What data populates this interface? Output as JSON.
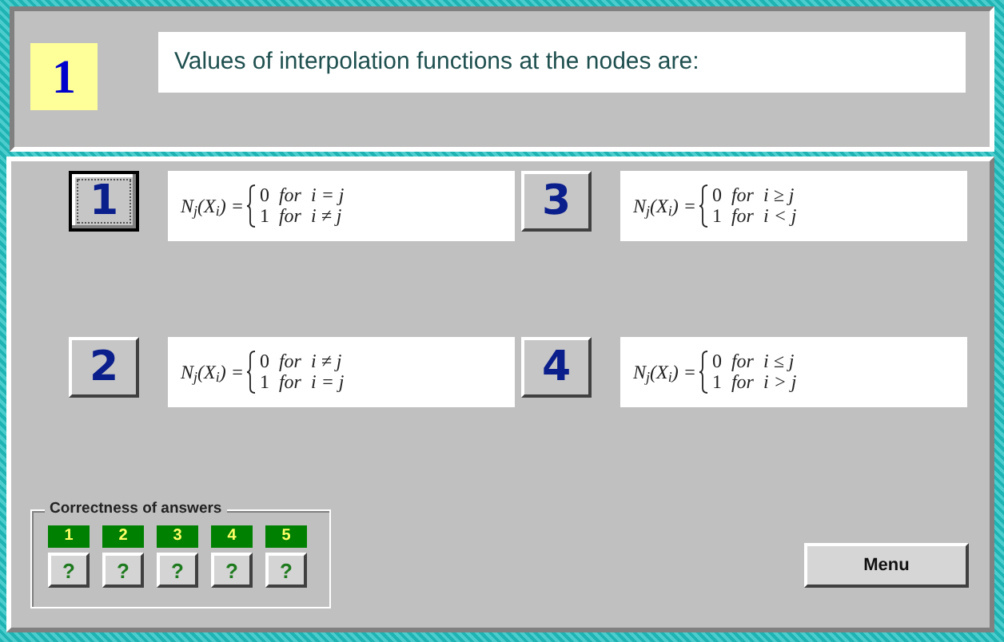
{
  "question": {
    "number": "1",
    "text": "Values of interpolation functions at the nodes are:"
  },
  "options": [
    {
      "label": "1",
      "selected": true,
      "lhs": "N$_{j}$(X$_{i}$) =",
      "cases": [
        {
          "value": "0",
          "word": "for",
          "condition": "i = j"
        },
        {
          "value": "1",
          "word": "for",
          "condition": "i ≠ j"
        }
      ]
    },
    {
      "label": "2",
      "selected": false,
      "lhs": "N$_{j}$(X$_{i}$) =",
      "cases": [
        {
          "value": "0",
          "word": "for",
          "condition": "i ≠ j"
        },
        {
          "value": "1",
          "word": "for",
          "condition": "i = j"
        }
      ]
    },
    {
      "label": "3",
      "selected": false,
      "lhs": "N$_{j}$(X$_{i}$) =",
      "cases": [
        {
          "value": "0",
          "word": "for",
          "condition": "i ≥ j"
        },
        {
          "value": "1",
          "word": "for",
          "condition": "i < j"
        }
      ]
    },
    {
      "label": "4",
      "selected": false,
      "lhs": "N$_{j}$(X$_{i}$) =",
      "cases": [
        {
          "value": "0",
          "word": "for",
          "condition": "i ≤ j"
        },
        {
          "value": "1",
          "word": "for",
          "condition": "i > j"
        }
      ]
    }
  ],
  "correctness": {
    "title": "Correctness of answers",
    "answers": [
      {
        "number": "1",
        "result": "?"
      },
      {
        "number": "2",
        "result": "?"
      },
      {
        "number": "3",
        "result": "?"
      },
      {
        "number": "4",
        "result": "?"
      },
      {
        "number": "5",
        "result": "?"
      }
    ]
  },
  "menu_button": "Menu"
}
